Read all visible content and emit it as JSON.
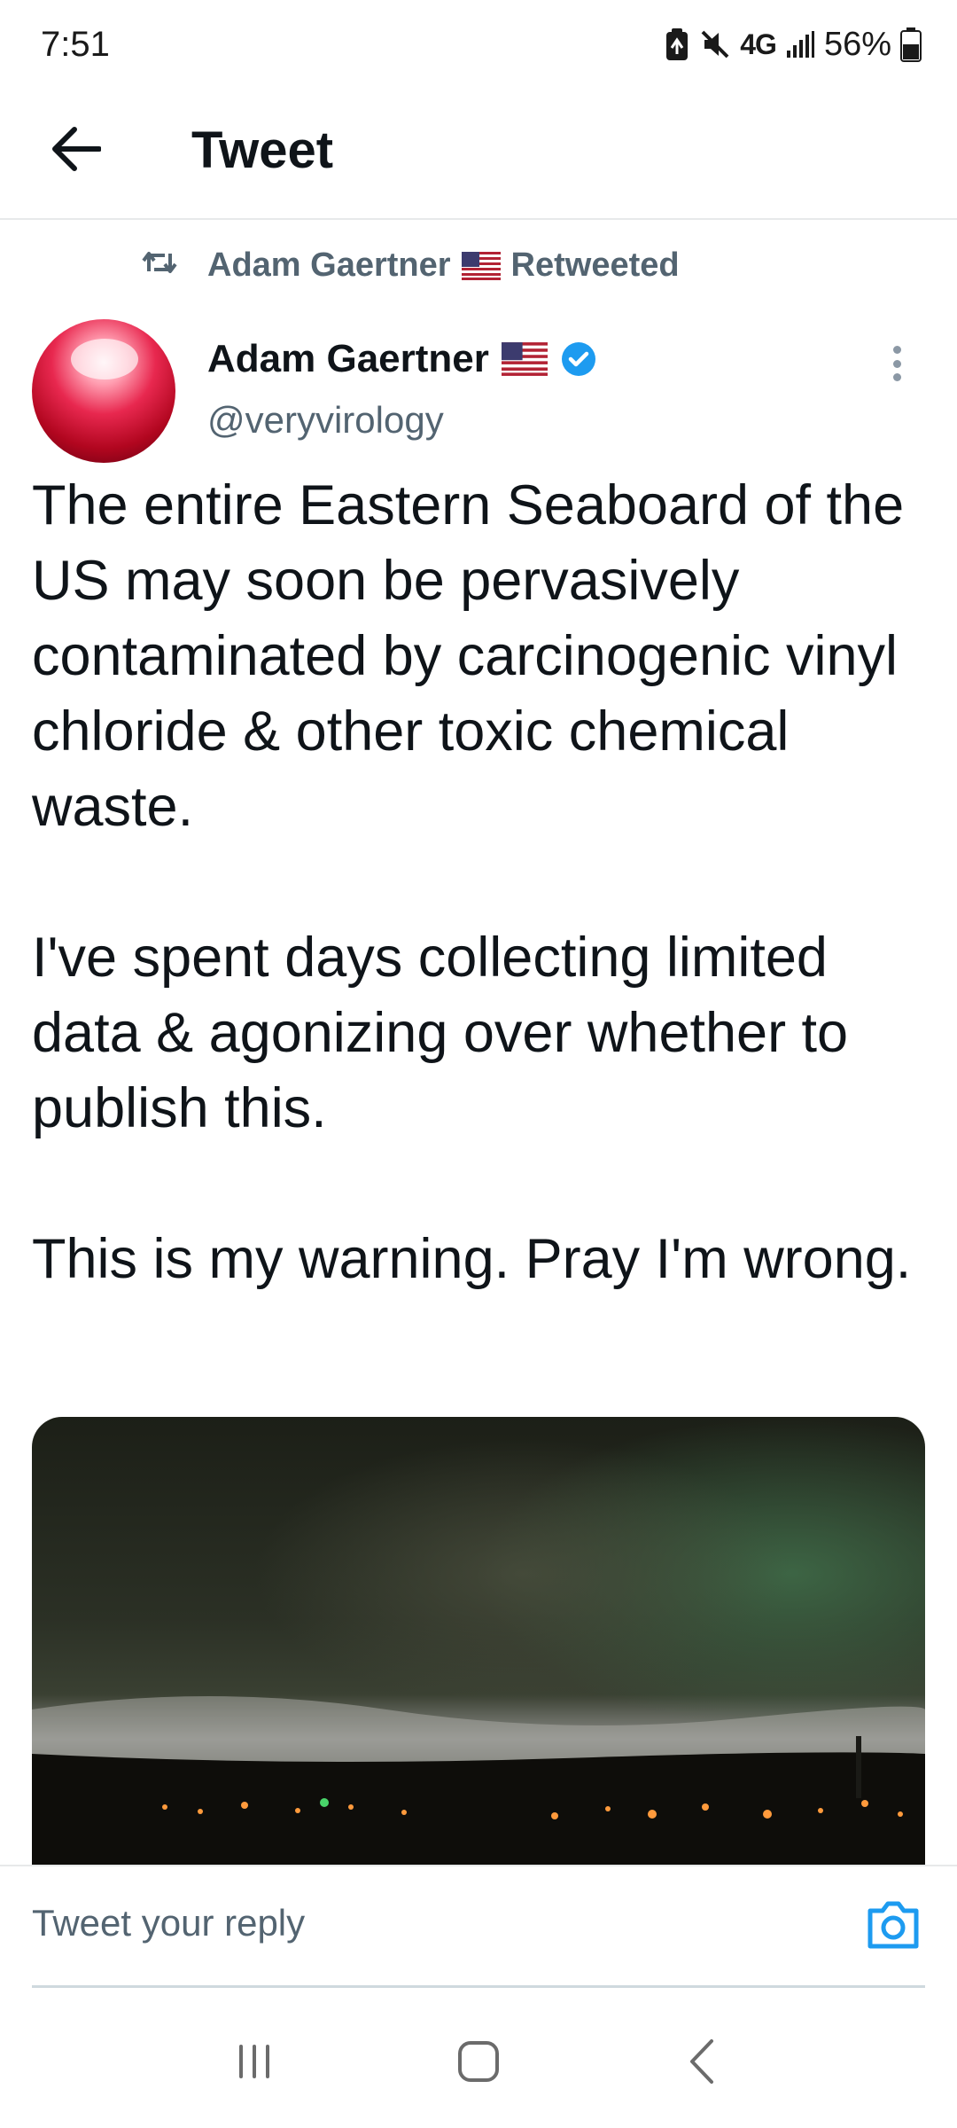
{
  "status_bar": {
    "time": "7:51",
    "network": "4G",
    "battery": "56%"
  },
  "header": {
    "title": "Tweet"
  },
  "retweet": {
    "name": "Adam Gaertner",
    "suffix": "Retweeted"
  },
  "author": {
    "name": "Adam Gaertner",
    "handle": "@veryvirology",
    "verified": true
  },
  "tweet": {
    "paragraphs": [
      "The entire Eastern Seaboard of the US may soon be pervasively contaminated by carcinogenic vinyl chloride & other toxic chemical waste.",
      "I've spent days collecting limited data & agonizing over whether to publish this.",
      "This is my warning. Pray I'm wrong."
    ]
  },
  "reply": {
    "placeholder": "Tweet your reply"
  },
  "colors": {
    "accent": "#1d9bf0",
    "secondary_text": "#536471"
  },
  "icons": {
    "back": "arrow-left-icon",
    "retweet": "retweet-icon",
    "verified": "verified-badge-icon",
    "more": "more-vertical-icon",
    "camera": "camera-icon",
    "nav_recent": "recent-apps-icon",
    "nav_home": "home-icon",
    "nav_back": "nav-back-icon"
  }
}
